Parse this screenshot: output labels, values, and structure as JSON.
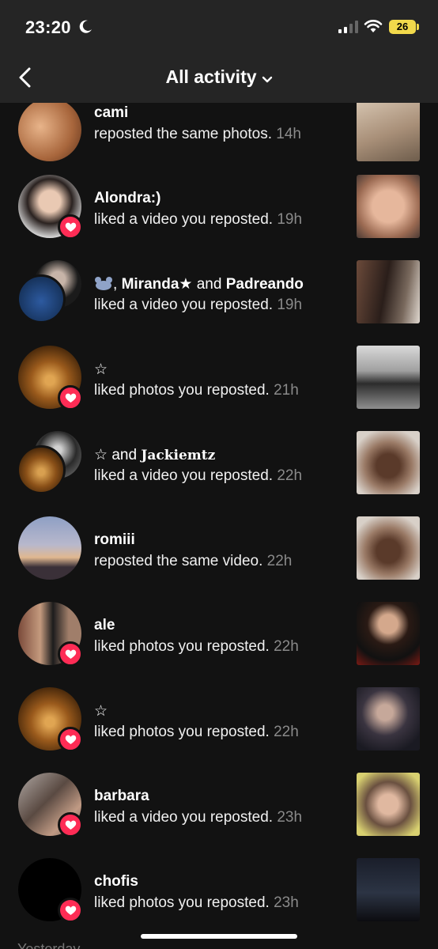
{
  "status_bar": {
    "time": "23:20",
    "battery": "26"
  },
  "nav": {
    "title": "All activity"
  },
  "colors": {
    "background": "#121212",
    "bar": "#252525",
    "badge": "#fe2c55",
    "timestamp": "#8a8a8a",
    "battery": "#f2d94b"
  },
  "activities": [
    {
      "name": "cami",
      "action": "reposted the same photos.",
      "time": "14h",
      "badge": "none"
    },
    {
      "name": "Alondra:)",
      "action": "liked a video you reposted.",
      "time": "19h",
      "badge": "heart"
    },
    {
      "name_parts": {
        "sep1": ", ",
        "name1": "Miranda★",
        "conj": " and ",
        "name2": "Padreando"
      },
      "action": "liked a video you reposted.",
      "time": "19h",
      "badge": "none",
      "icon": "bear-emoji-icon"
    },
    {
      "name": "☆",
      "action": "liked photos you reposted.",
      "time": "21h",
      "badge": "heart"
    },
    {
      "name_parts": {
        "name1": "☆",
        "conj": " and ",
        "name2": "Jackiemtz"
      },
      "action": "liked a video you reposted.",
      "time": "22h",
      "badge": "none"
    },
    {
      "name": "romiii",
      "action": "reposted the same video.",
      "time": "22h",
      "badge": "none"
    },
    {
      "name": "ale",
      "action": "liked photos you reposted.",
      "time": "22h",
      "badge": "heart"
    },
    {
      "name": "☆",
      "action": "liked photos you reposted.",
      "time": "22h",
      "badge": "heart"
    },
    {
      "name": "barbara",
      "action": "liked a video you reposted.",
      "time": "23h",
      "badge": "heart"
    },
    {
      "name": "chofis",
      "action": "liked photos you reposted.",
      "time": "23h",
      "badge": "heart"
    }
  ],
  "section_hint": "Yesterday"
}
